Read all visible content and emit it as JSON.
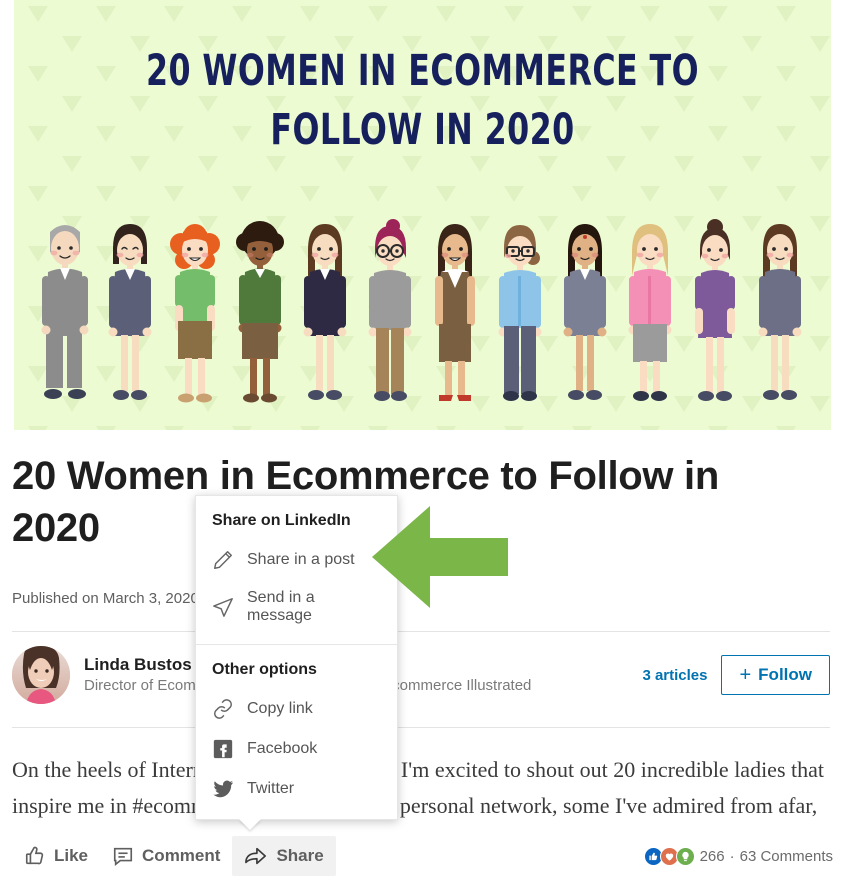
{
  "hero": {
    "title": "20 WOMEN IN ECOMMERCE TO\nFOLLOW IN 2020",
    "background_color": "#edfbd2",
    "title_color": "#16205c",
    "figure_count": 12
  },
  "article": {
    "title": "20 Women in Ecommerce to Follow in 2020",
    "published": "Published on March 3, 2020",
    "body": "On the heels of International Women's Day, I'm excited to shout out 20 incredible ladies that inspire me in #ecommerce. Some are in my personal network, some I've admired from afar, all"
  },
  "author": {
    "name": "Linda Bustos",
    "headline": "Director of Ecommerce Research | Author at Ecommerce Illustrated",
    "articles_count": "3 articles",
    "follow_label": "Follow",
    "follow_plus": "+",
    "avatar_alt": "avatar"
  },
  "actions": {
    "like": "Like",
    "comment": "Comment",
    "share": "Share",
    "active": "share"
  },
  "reactions": {
    "count": "266",
    "separator": "·",
    "comments": "63 Comments",
    "types": [
      "like",
      "love",
      "insightful"
    ],
    "colors": {
      "like": "#0a66c2",
      "love": "#df704d",
      "insightful": "#6dae4f"
    }
  },
  "share_dropdown": {
    "section_1_title": "Share on LinkedIn",
    "section_1_items": [
      {
        "label": "Share in a post",
        "icon": "pencil-icon"
      },
      {
        "label": "Send in a message",
        "icon": "send-icon"
      }
    ],
    "section_2_title": "Other options",
    "section_2_items": [
      {
        "label": "Copy link",
        "icon": "link-icon"
      },
      {
        "label": "Facebook",
        "icon": "facebook-icon"
      },
      {
        "label": "Twitter",
        "icon": "twitter-icon"
      }
    ]
  },
  "annotation": {
    "arrow_color": "#7ab648",
    "arrow_direction": "left",
    "points_at": "share-in-a-post"
  },
  "theme": {
    "link_blue": "#0073b1",
    "text_dark": "#1f1f1f",
    "text_muted": "#7a7a7a"
  }
}
